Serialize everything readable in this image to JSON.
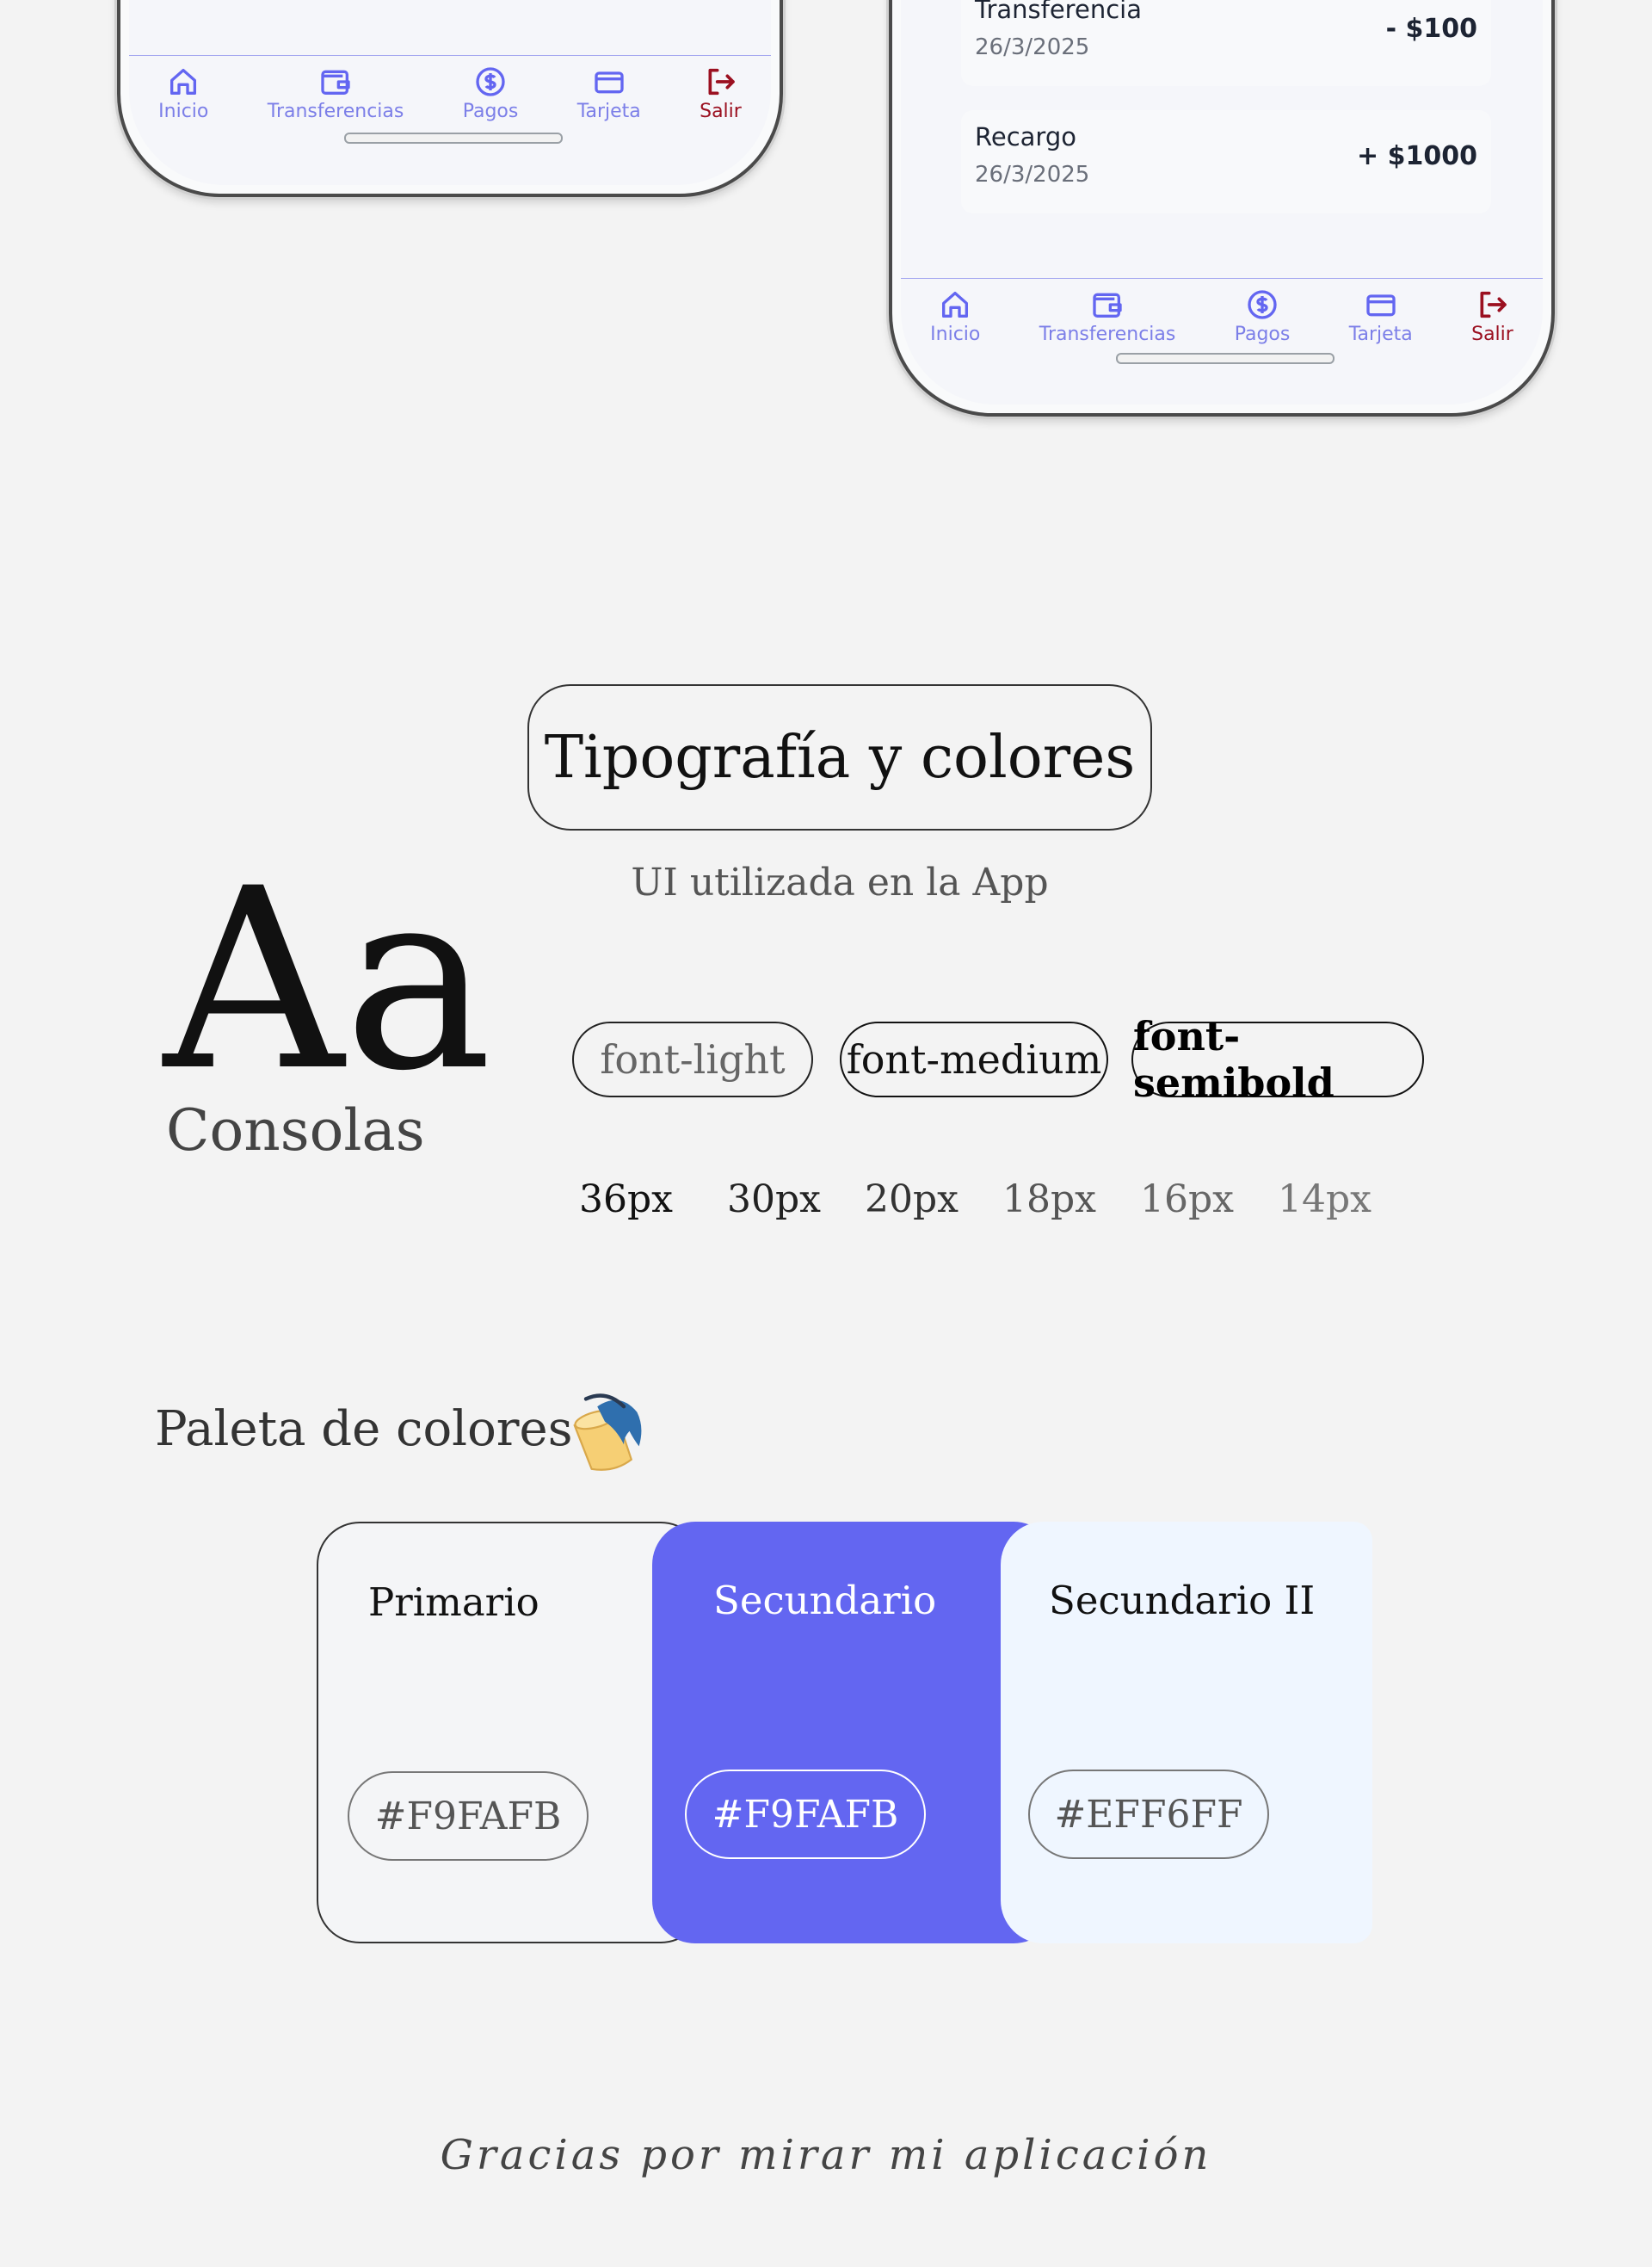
{
  "nav": {
    "items": [
      {
        "label": "Inicio",
        "icon": "home-icon"
      },
      {
        "label": "Transferencias",
        "icon": "wallet-icon"
      },
      {
        "label": "Pagos",
        "icon": "dollar-badge-icon"
      },
      {
        "label": "Tarjeta",
        "icon": "credit-card-icon"
      },
      {
        "label": "Salir",
        "icon": "logout-icon"
      }
    ],
    "accent": "#6366f1",
    "exit_color": "#9b1020"
  },
  "transactions": [
    {
      "title": "Transferencia",
      "date": "26/3/2025",
      "amount": "- $100"
    },
    {
      "title": "Recargo",
      "date": "26/3/2025",
      "amount": "+ $1000"
    }
  ],
  "typography": {
    "heading": "Tipografía y colores",
    "subtitle": "UI utilizada en la App",
    "sample": "Aa",
    "font_name": "Consolas",
    "weights": [
      "font-light",
      "font-medium",
      "font-semibold"
    ],
    "sizes": [
      "36px",
      "30px",
      "20px",
      "18px",
      "16px",
      "14px"
    ]
  },
  "palette": {
    "heading": "Paleta de colores",
    "icon": "paint-bucket-icon",
    "colors": [
      {
        "name": "Primario",
        "hex": "#F9FAFB",
        "swatch": "#f4f5f7"
      },
      {
        "name": "Secundario",
        "hex": "#F9FAFB",
        "swatch": "#6366f1"
      },
      {
        "name": "Secundario II",
        "hex": "#EFF6FF",
        "swatch": "#eff6ff"
      }
    ]
  },
  "footer": "Gracias por mirar mi aplicación"
}
